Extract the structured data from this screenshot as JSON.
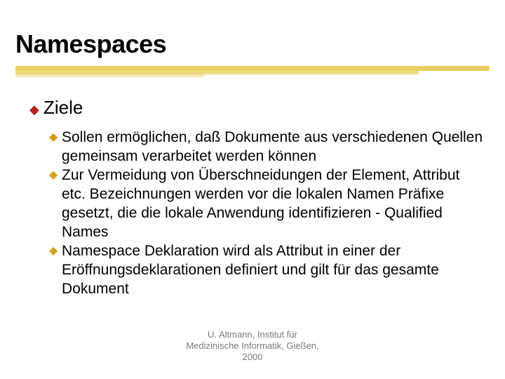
{
  "title": "Namespaces",
  "bullet_glyph_l1": "◆",
  "bullet_glyph_l2": "◆",
  "level1": {
    "text": "Ziele"
  },
  "level2_items": [
    "Sollen ermöglichen, daß Dokumente aus verschiedenen Quellen gemeinsam verarbeitet werden können",
    "Zur Vermeidung von Überschneidungen der Element, Attribut etc. Bezeichnungen werden vor die lokalen Namen Präfixe gesetzt, die die lokale Anwendung identifizieren - Qualified Names",
    "Namespace Deklaration wird als Attribut in einer der Eröffnungsdeklarationen definiert und gilt für das gesamte Dokument"
  ],
  "footer": {
    "line1": "U. Altmann, Institut für",
    "line2": "Medizinische Informatik, Gießen,",
    "line3": "2000"
  }
}
